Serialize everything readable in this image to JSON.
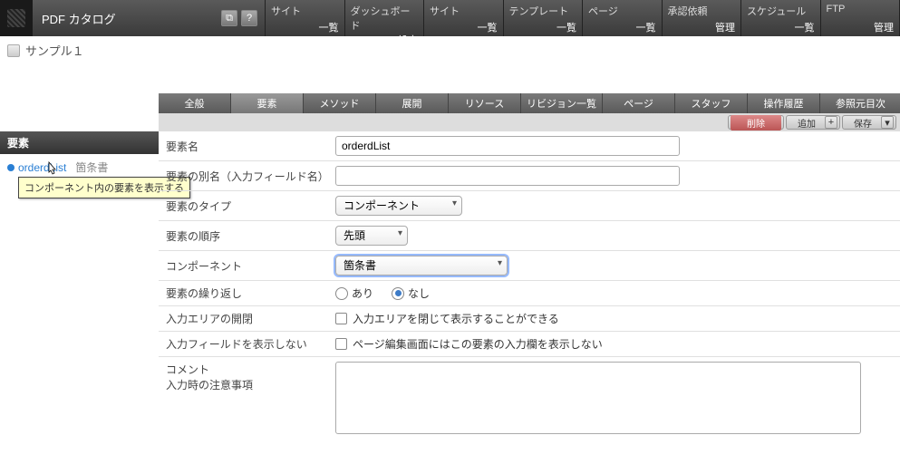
{
  "header": {
    "title": "PDF カタログ"
  },
  "topnav": [
    {
      "top": "サイト",
      "bottom": "一覧"
    },
    {
      "top": "ダッシュボード",
      "bottom": "設定"
    },
    {
      "top": "サイト",
      "bottom": "一覧"
    },
    {
      "top": "テンプレート",
      "bottom": "一覧"
    },
    {
      "top": "ページ",
      "bottom": "一覧"
    },
    {
      "top": "承認依頼",
      "bottom": "管理"
    },
    {
      "top": "スケジュール",
      "bottom": "一覧"
    },
    {
      "top": "FTP",
      "bottom": "管理"
    }
  ],
  "pageline": "サンプル１",
  "tabs": [
    "全般",
    "要素",
    "メソッド",
    "展開",
    "リソース",
    "リビジョン一覧",
    "ページ",
    "スタッフ",
    "操作履歴",
    "参照元目次"
  ],
  "tabs_active_index": 1,
  "actions": {
    "delete": "削除",
    "add": "追加",
    "save": "保存"
  },
  "left": {
    "title": "要素",
    "tree_item": "orderdList",
    "tree_sub": "箇条書",
    "tooltip": "コンポーネント内の要素を表示する"
  },
  "form": {
    "name": {
      "label": "要素名",
      "value": "orderdList"
    },
    "alias": {
      "label": "要素の別名（入力フィールド名）",
      "value": ""
    },
    "type": {
      "label": "要素のタイプ",
      "selected": "コンポーネント"
    },
    "order": {
      "label": "要素の順序",
      "selected": "先頭"
    },
    "component": {
      "label": "コンポーネント",
      "selected": "箇条書"
    },
    "repeat": {
      "label": "要素の繰り返し",
      "option_yes": "あり",
      "option_no": "なし",
      "selected": "no"
    },
    "collapse": {
      "label": "入力エリアの開閉",
      "text": "入力エリアを閉じて表示することができる"
    },
    "hidefield": {
      "label": "入力フィールドを表示しない",
      "text": "ページ編集画面にはこの要素の入力欄を表示しない"
    },
    "comment": {
      "label": "コメント",
      "label2": "入力時の注意事項",
      "value": ""
    }
  }
}
